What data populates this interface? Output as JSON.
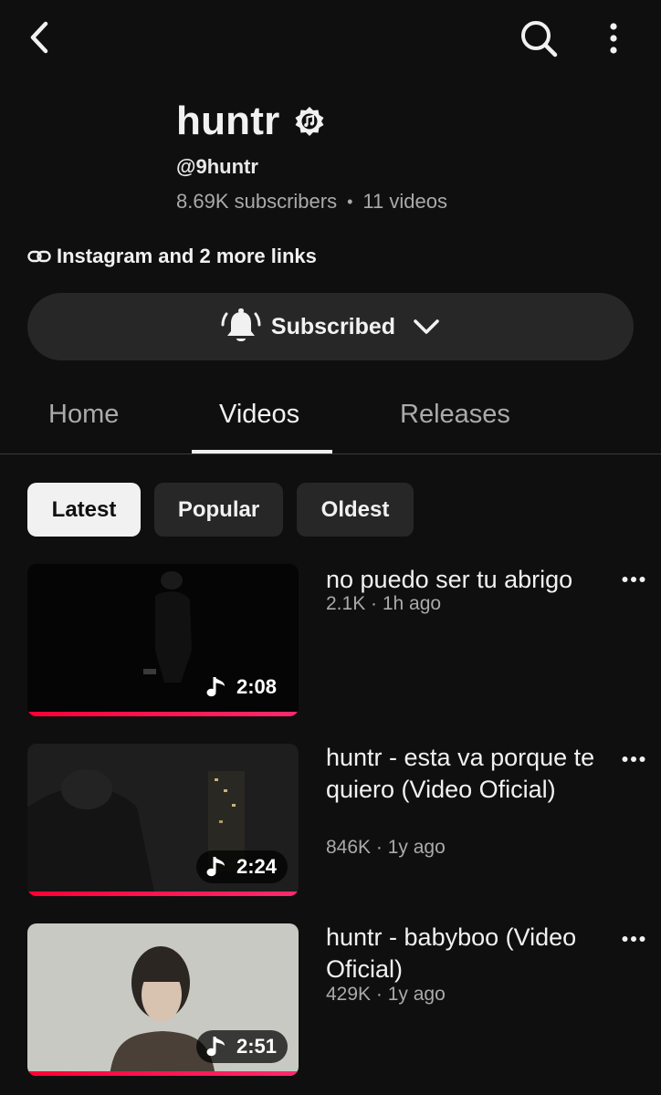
{
  "icons": {
    "back": "chevron-left-icon",
    "search": "search-icon",
    "more": "more-vert-icon",
    "verified": "verified-badge-icon",
    "link": "link-icon",
    "bell": "bell-ringing-icon",
    "dropdown": "chevron-down-icon",
    "note": "music-note-icon",
    "video_menu": "more-horiz-icon"
  },
  "colors": {
    "background": "#0f0f0f",
    "surface": "#272727",
    "text_primary": "#f1f1f1",
    "text_secondary": "#aaaaaa",
    "progress": "#ff0033"
  },
  "channel": {
    "name": "huntr",
    "handle": "@9huntr",
    "subscribers": "8.69K subscribers",
    "separator": "•",
    "videos": "11 videos",
    "links": "Instagram and 2 more links"
  },
  "subscribe": {
    "label": "Subscribed"
  },
  "tabs": [
    {
      "label": "Home",
      "active": false
    },
    {
      "label": "Videos",
      "active": true
    },
    {
      "label": "Releases",
      "active": false
    }
  ],
  "filters": [
    {
      "label": "Latest",
      "selected": true
    },
    {
      "label": "Popular",
      "selected": false
    },
    {
      "label": "Oldest",
      "selected": false
    }
  ],
  "videos": [
    {
      "title": "no puedo ser tu abrigo",
      "meta": "2.1K · 1h ago",
      "duration": "2:08",
      "watched_fraction": 1.0
    },
    {
      "title": "huntr - esta va porque te quiero (Video Oficial)",
      "meta": "846K · 1y ago",
      "duration": "2:24",
      "watched_fraction": 1.0
    },
    {
      "title": "huntr - babyboo (Video Oficial)",
      "meta": "429K · 1y ago",
      "duration": "2:51",
      "watched_fraction": 1.0
    }
  ]
}
